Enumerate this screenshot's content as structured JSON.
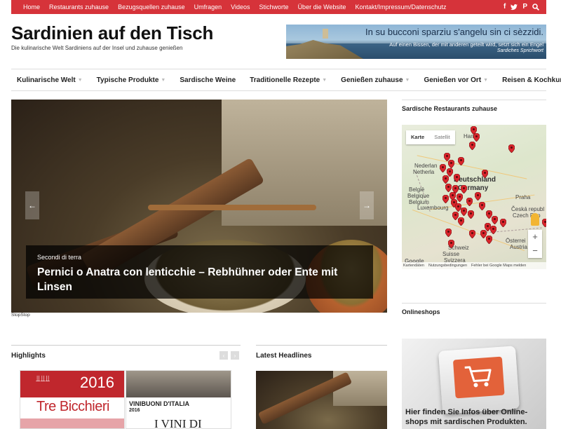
{
  "topnav": {
    "items": [
      "Home",
      "Restaurants zuhause",
      "Bezugsquellen zuhause",
      "Umfragen",
      "Videos",
      "Stichworte",
      "Über die Website",
      "Kontakt/Impressum/Datenschutz"
    ],
    "social": [
      "facebook-icon",
      "twitter-icon",
      "pinterest-icon",
      "search-icon"
    ],
    "color": "#d6333a"
  },
  "header": {
    "title": "Sardinien auf den Tisch",
    "tagline": "Die kulinarische Welt Sardiniens auf der Insel und zuhause genießen",
    "banner": {
      "quote": "In su bucconi sparziu s'angelu sin ci sèzzidi.",
      "translation": "Auf einen Bissen, der mit anderen geteilt wird, setzt sich ein Engel",
      "source": "Sardiches Sprichwort"
    }
  },
  "mainnav": {
    "items": [
      {
        "label": "Kulinarische Welt",
        "dropdown": true
      },
      {
        "label": "Typische Produkte",
        "dropdown": true
      },
      {
        "label": "Sardische Weine",
        "dropdown": false
      },
      {
        "label": "Traditionelle Rezepte",
        "dropdown": true
      },
      {
        "label": "Genießen zuhause",
        "dropdown": true
      },
      {
        "label": "Genießen vor Ort",
        "dropdown": true
      },
      {
        "label": "Reisen & Kochkurse",
        "dropdown": false
      }
    ]
  },
  "slider": {
    "category": "Secondi di terra",
    "title": "Pernici o Anatra con lenticchie – Rebhühner oder Ente mit Linsen",
    "prev": "←",
    "next": "→",
    "stop_label": "StopStop"
  },
  "sidebar": {
    "restaurants_title": "Sardische Restaurants zuhause",
    "map": {
      "type_buttons": [
        "Karte",
        "Satellit"
      ],
      "labels": {
        "hamburg": "Ham",
        "nederland": "Nederlan",
        "netherlands": "Netherla",
        "deutschland": "Deutschland",
        "germany": "Germany",
        "belgie": "België",
        "belgique": "Belgique",
        "belgium": "Belgium",
        "luxembourg": "Luxembourg",
        "praha": "Praha",
        "cesko": "Česká republ",
        "czech": "Czech Rep",
        "schweiz": "Schweiz",
        "suisse": "Suisse",
        "svizzera": "Svizzera",
        "osterreich": "Österrei",
        "austria": "Austria",
        "google": "Google"
      },
      "zoom_in": "+",
      "zoom_out": "−",
      "footer": [
        "Kartendaten",
        "Nutzungsbedingungen",
        "Fehler bei Google Maps melden"
      ],
      "pin_color": "#d9252b"
    },
    "shops_title": "Onlineshops",
    "shops_text": "Hier finden Sie Infos über Online-shops mit sardischen Produkten."
  },
  "highlights": {
    "title": "Highlights",
    "arrows": [
      "‹",
      "›"
    ],
    "thumb1": {
      "year": "2016",
      "text": "Tre Bicchieri"
    },
    "thumb2": {
      "brand": "VINIBUONI D'ITALIA",
      "year": "2016",
      "text": "I VINI DI"
    }
  },
  "latest": {
    "title": "Latest Headlines"
  }
}
